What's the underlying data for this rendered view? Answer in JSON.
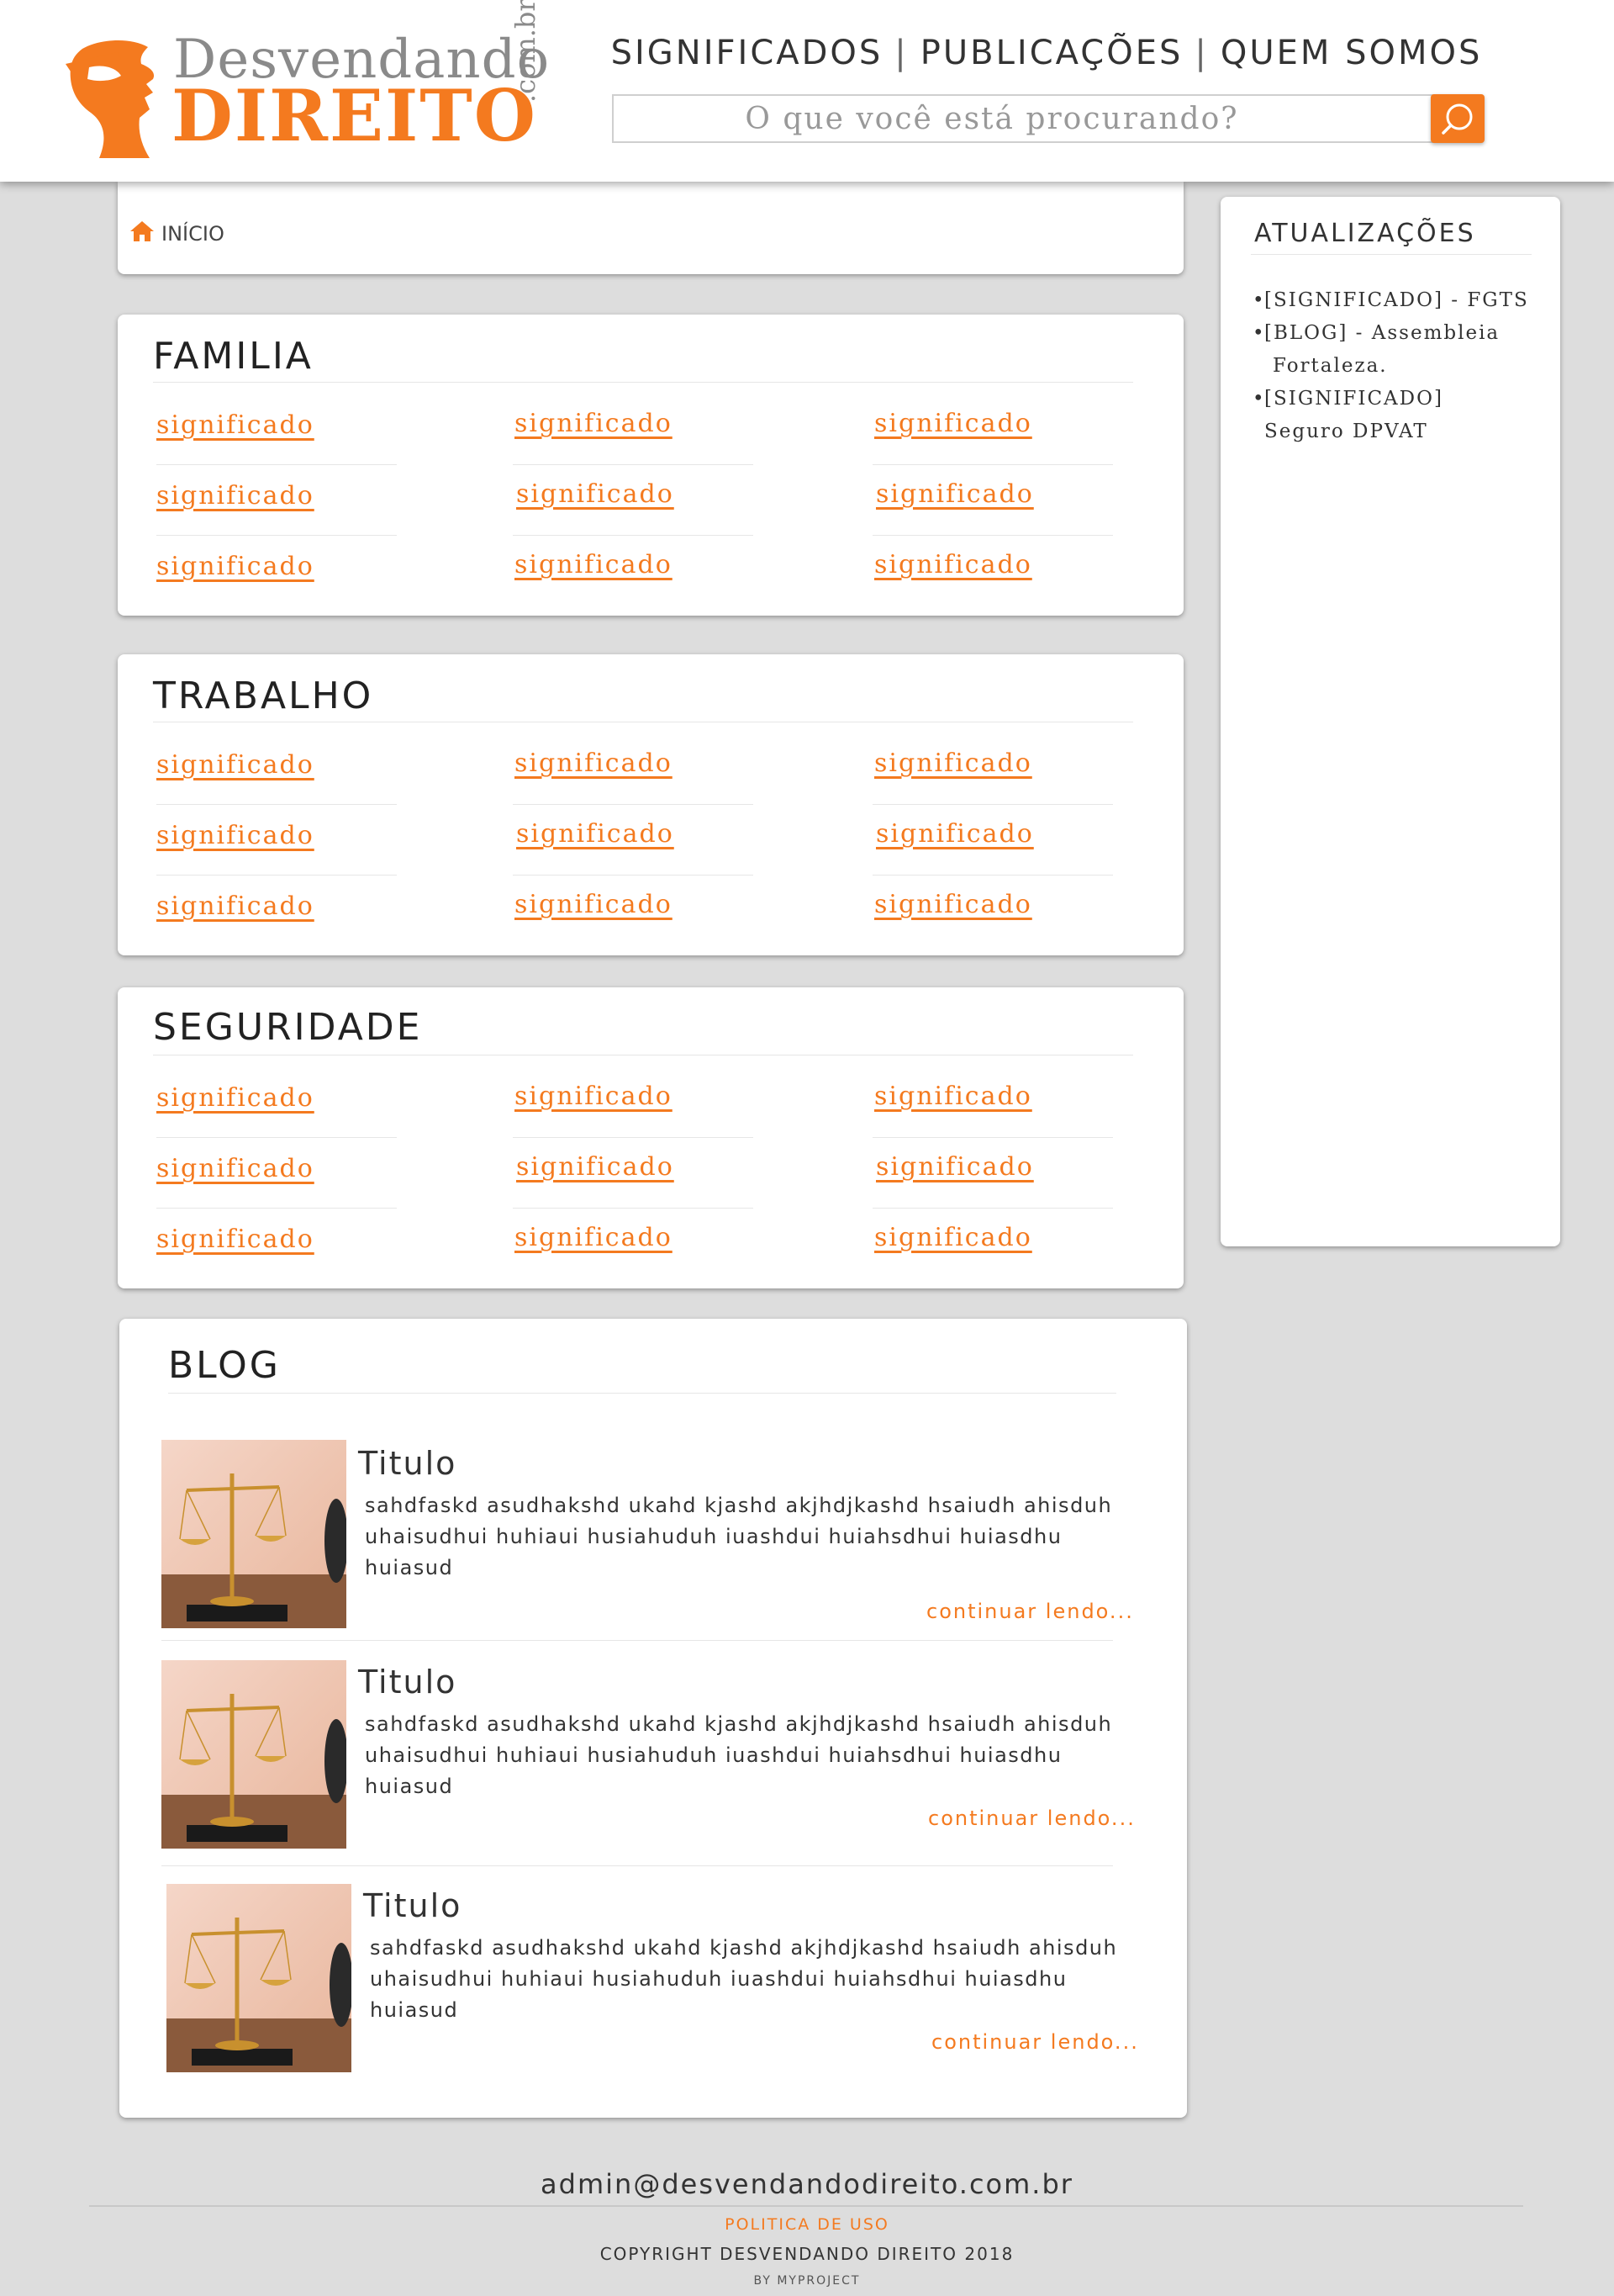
{
  "logo": {
    "line1": "Desvendando",
    "line2": "DIREITO",
    "domain": ".com.br"
  },
  "nav": {
    "items": [
      "SIGNIFICADOS",
      "PUBLICAÇÕES",
      "QUEM SOMOS"
    ],
    "separator": "|"
  },
  "search": {
    "placeholder": "O que você está procurando?",
    "icon": "search-icon"
  },
  "breadcrumb": {
    "icon": "home-icon",
    "label": "INÍCIO"
  },
  "sections": [
    {
      "title": "FAMILIA",
      "links": [
        "significado",
        "significado",
        "significado",
        "significado",
        "significado",
        "significado",
        "significado",
        "significado",
        "significado"
      ]
    },
    {
      "title": "TRABALHO",
      "links": [
        "significado",
        "significado",
        "significado",
        "significado",
        "significado",
        "significado",
        "significado",
        "significado",
        "significado"
      ]
    },
    {
      "title": "SEGURIDADE",
      "links": [
        "significado",
        "significado",
        "significado",
        "significado",
        "significado",
        "significado",
        "significado",
        "significado",
        "significado"
      ]
    }
  ],
  "sidebar": {
    "title": "ATUALIZAÇÕES",
    "items": [
      {
        "line1": "[SIGNIFICADO] - FGTS",
        "line2": ""
      },
      {
        "line1": "[BLOG] - Assembleia",
        "line2": "Fortaleza."
      },
      {
        "line1": "[SIGNIFICADO]",
        "line2": "Seguro DPVAT"
      }
    ]
  },
  "blog": {
    "title": "BLOG",
    "posts": [
      {
        "title": "Titulo",
        "body_line1": "sahdfaskd asudhakshd ukahd kjashd akjhdjkashd hsaiudh ahisduh",
        "body_line2": "uhaisudhui huhiaui husiahuduh iuashdui huiahsdhui huiasdhu huiasud",
        "more": "continuar lendo..."
      },
      {
        "title": "Titulo",
        "body_line1": "sahdfaskd asudhakshd ukahd kjashd akjhdjkashd hsaiudh ahisduh",
        "body_line2": "uhaisudhui huhiaui husiahuduh iuashdui huiahsdhui huiasdhu huiasud",
        "more": "continuar lendo..."
      },
      {
        "title": "Titulo",
        "body_line1": "sahdfaskd asudhakshd ukahd kjashd akjhdjkashd hsaiudh ahisduh",
        "body_line2": "uhaisudhui huhiaui husiahuduh iuashdui huiahsdhui huiasdhu huiasud",
        "more": "continuar lendo..."
      }
    ]
  },
  "footer": {
    "email": "admin@desvendandodireito.com.br",
    "policy": "POLITICA DE USO",
    "copyright": "COPYRIGHT DESVENDANDO DIREITO 2018",
    "by": "BY MYPROJECT"
  },
  "colors": {
    "accent": "#f47a1f",
    "background": "#dddddd",
    "card": "#ffffff",
    "logo_gray": "#8a8a8a"
  }
}
